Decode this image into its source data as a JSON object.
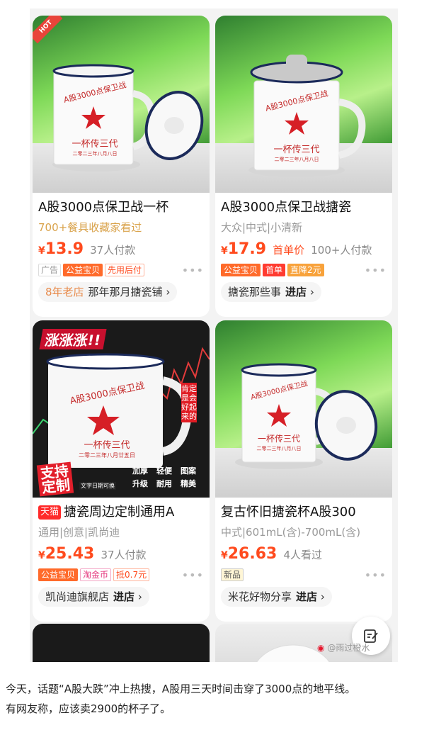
{
  "products": [
    {
      "title": "A股3000点保卫战一杯",
      "subtitle": "700+餐具收藏家看过",
      "price_symbol": "¥",
      "price": "13.9",
      "meta": "37人付款",
      "tags": [
        "广告",
        "公益宝贝",
        "先用后付"
      ],
      "shop_badge": "8年老店",
      "shop_name": "那年那月搪瓷铺",
      "shop_suffix": "›",
      "hot": "HOT",
      "mug_text": [
        "A股3000点保卫战",
        "一杯传三代",
        "二零二三年八月八日"
      ]
    },
    {
      "title": "A股3000点保卫战搪瓷",
      "subtitle": "大众|中式|小清新",
      "price_symbol": "¥",
      "price": "17.9",
      "first_price": "首单价",
      "meta": "100+人付款",
      "tags": [
        "公益宝贝",
        "首单",
        "直降2元"
      ],
      "shop_name": "搪瓷那些事",
      "shop_enter": "进店",
      "shop_suffix": "›",
      "mug_text": [
        "A股3000点保卫战",
        "一杯传三代",
        "二零二三年八月八日"
      ]
    },
    {
      "title": "搪瓷周边定制通用A",
      "title_badge": "天猫",
      "subtitle": "通用|创意|凯尚迪",
      "price_symbol": "¥",
      "price": "25.43",
      "meta": "37人付款",
      "tags": [
        "公益宝贝",
        "淘金币",
        "抵0.7元"
      ],
      "shop_name": "凯尚迪旗舰店",
      "shop_enter": "进店",
      "shop_suffix": "›",
      "banner": "涨涨涨!!",
      "side_text": "肯定是会好起来的",
      "custom": [
        "支持",
        "定制"
      ],
      "custom_sub": "文字日期可换",
      "features": [
        "加厚",
        "轻便",
        "图案",
        "升级",
        "耐用",
        "精美"
      ],
      "mug_text": [
        "A股3000点保卫战",
        "一杯传三代",
        "二零二三年八月廿五日"
      ]
    },
    {
      "title": "复古怀旧搪瓷杯A股300",
      "subtitle": "中式|601mL(含)-700mL(含)",
      "price_symbol": "¥",
      "price": "26.63",
      "meta": "4人看过",
      "tags": [
        "新品"
      ],
      "shop_name": "米花好物分享",
      "shop_enter": "进店",
      "shop_suffix": "›",
      "mug_text": [
        "A股3000点保卫战",
        "一杯传三代",
        "二零二三年八月八日"
      ]
    }
  ],
  "watermark": "@雨过橙水",
  "caption": [
    "今天，话题“A股大跌”冲上热搜，A股用三天时间击穿了3000点的地平线。",
    "有网友称，应该卖2900的杯子了。"
  ],
  "colors": {
    "price": "#ff4a1d",
    "tag_orange": "#ff6a2a",
    "tmall": "#ff2a2a"
  },
  "icons": [
    "more-dots-icon",
    "edit-note-icon",
    "weibo-icon"
  ]
}
